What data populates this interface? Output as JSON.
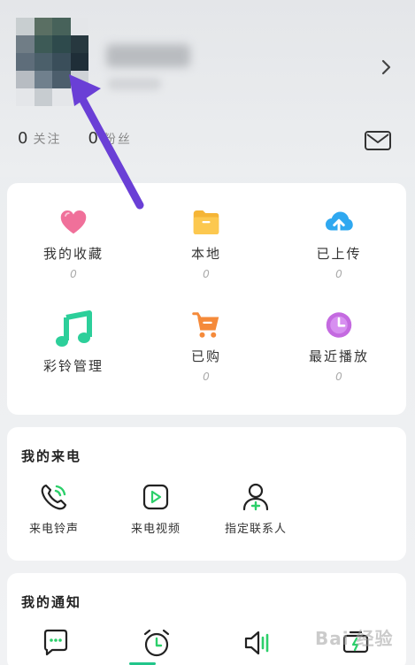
{
  "profile": {
    "following_count": "0",
    "following_label": "关注",
    "fans_count": "0",
    "fans_label": "粉丝"
  },
  "main_grid": [
    {
      "label": "我的收藏",
      "count": "0",
      "icon": "heart-icon"
    },
    {
      "label": "本地",
      "count": "0",
      "icon": "folder-icon"
    },
    {
      "label": "已上传",
      "count": "0",
      "icon": "cloud-upload-icon"
    },
    {
      "label": "彩铃管理",
      "count": "",
      "icon": "music-note-icon"
    },
    {
      "label": "已购",
      "count": "0",
      "icon": "cart-icon"
    },
    {
      "label": "最近播放",
      "count": "0",
      "icon": "clock-icon"
    }
  ],
  "incoming_call": {
    "title": "我的来电",
    "items": [
      {
        "label": "来电铃声",
        "icon": "phone-ring-icon"
      },
      {
        "label": "来电视频",
        "icon": "video-play-icon"
      },
      {
        "label": "指定联系人",
        "icon": "add-contact-icon"
      }
    ]
  },
  "notifications": {
    "title": "我的通知",
    "items": [
      {
        "icon": "message-icon"
      },
      {
        "icon": "alarm-icon"
      },
      {
        "icon": "speaker-icon"
      },
      {
        "icon": "battery-icon"
      }
    ]
  },
  "watermark": "Bai 经验",
  "colors": {
    "accent": "#22c58a",
    "heart": "#f0709a",
    "folder": "#f5b536",
    "cloud": "#2fa8f0",
    "music": "#2ccf9a",
    "cart": "#f58a3a",
    "recent": "#c46ae0",
    "arrow": "#6a3fd6"
  }
}
